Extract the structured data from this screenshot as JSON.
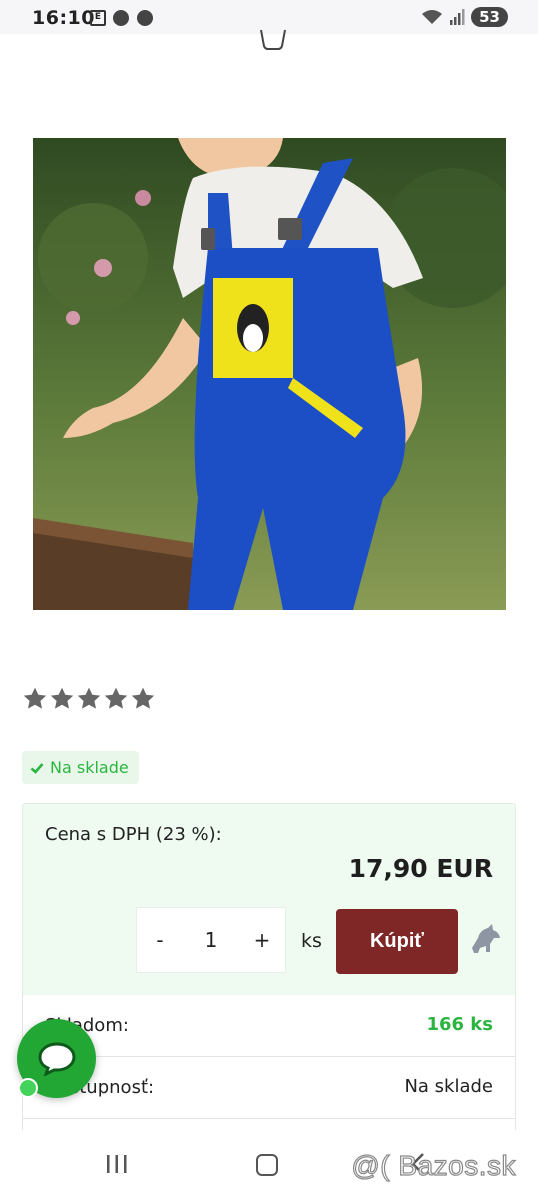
{
  "status_bar": {
    "time": "16:10",
    "battery": "53",
    "icons": [
      "e-icon",
      "dots-icon",
      "dots-icon",
      "wifi-icon",
      "signal-icon"
    ]
  },
  "product": {
    "image_icon": "product-photo-overalls",
    "rating_stars": 5,
    "rating_value": 5,
    "availability_badge": "Na sklade"
  },
  "price_box": {
    "label": "Cena s DPH (23 %):",
    "price": "17,90 EUR",
    "quantity_minus": "-",
    "quantity": "1",
    "quantity_plus": "+",
    "unit": "ks",
    "buy_label": "Kúpiť"
  },
  "info_rows": [
    {
      "label": "Skladom:",
      "value": "166 ks"
    },
    {
      "label": "Dostupnosť:",
      "value": "Na sklade"
    }
  ],
  "colors": {
    "accent_green": "#2bb540",
    "buy_button": "#7f2727",
    "price_bg": "#effaf0",
    "chat_green": "#22a735"
  },
  "watermark": "@( Bazos.sk"
}
